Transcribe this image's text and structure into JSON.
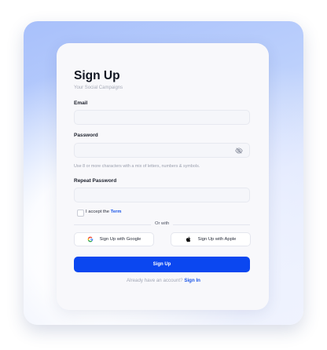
{
  "form": {
    "title": "Sign Up",
    "subtitle": "Your Social Campaigns",
    "email_label": "Email",
    "password_label": "Password",
    "password_hint": "Use 8 or more characters with a mix of letters, numbers & symbols.",
    "repeat_password_label": "Repeat Password",
    "accept_prefix": "I accept the",
    "accept_link": "Term",
    "divider_text": "Or with",
    "google_button": "Sign Up with Google",
    "apple_button": "Sign Up with Apple",
    "submit_button": "Sign Up",
    "footer_text": "Already have an account?",
    "footer_link": "Sign In"
  },
  "icons": {
    "password_toggle": "eye-off-icon",
    "google": "google-icon",
    "apple": "apple-icon"
  },
  "colors": {
    "primary": "#0b47f0",
    "link": "#1a55e8",
    "card_background": "#f8f8fb"
  }
}
